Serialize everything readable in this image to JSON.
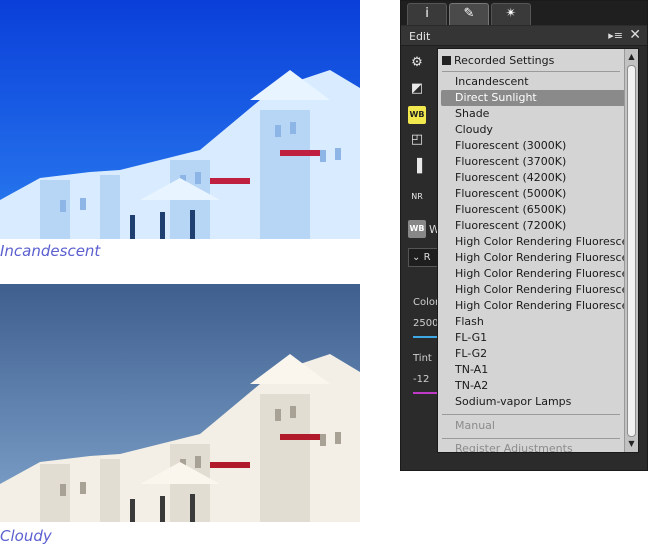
{
  "captions": {
    "top": "Incandescent",
    "bottom": "Cloudy"
  },
  "panel": {
    "tabs": [
      {
        "icon": "info-icon",
        "glyph": "i"
      },
      {
        "icon": "edit-pencil-icon",
        "glyph": "✎"
      },
      {
        "icon": "magic-wand-icon",
        "glyph": "✴"
      }
    ],
    "edit_title": "Edit",
    "header_menu_glyph": "▸≡",
    "header_close_glyph": "✕",
    "tool_icons": {
      "gear": "⚙",
      "exposure": "◩",
      "wb": "WB",
      "levels": "◰",
      "contrast": "▐",
      "nr": "NR"
    },
    "wb_row_label": "W",
    "wb_select_value": "R",
    "color_label": "Color",
    "color_value": "2500",
    "tint_label": "Tint",
    "tint_value": "-12"
  },
  "dropdown": {
    "recorded_label": "Recorded Settings",
    "items": [
      {
        "label": "Incandescent",
        "selected": false
      },
      {
        "label": "Direct Sunlight",
        "selected": true
      },
      {
        "label": "Shade",
        "selected": false
      },
      {
        "label": "Cloudy",
        "selected": false
      },
      {
        "label": "Fluorescent (3000K)",
        "selected": false
      },
      {
        "label": "Fluorescent (3700K)",
        "selected": false
      },
      {
        "label": "Fluorescent (4200K)",
        "selected": false
      },
      {
        "label": "Fluorescent (5000K)",
        "selected": false
      },
      {
        "label": "Fluorescent (6500K)",
        "selected": false
      },
      {
        "label": "Fluorescent (7200K)",
        "selected": false
      },
      {
        "label": "High Color Rendering Fluoresce...",
        "selected": false
      },
      {
        "label": "High Color Rendering Fluoresce...",
        "selected": false
      },
      {
        "label": "High Color Rendering Fluoresce...",
        "selected": false
      },
      {
        "label": "High Color Rendering Fluoresce...",
        "selected": false
      },
      {
        "label": "High Color Rendering Fluoresce...",
        "selected": false
      },
      {
        "label": "Flash",
        "selected": false
      },
      {
        "label": "FL-G1",
        "selected": false
      },
      {
        "label": "FL-G2",
        "selected": false
      },
      {
        "label": "TN-A1",
        "selected": false
      },
      {
        "label": "TN-A2",
        "selected": false
      },
      {
        "label": "Sodium-vapor Lamps",
        "selected": false
      }
    ],
    "manual_label": "Manual",
    "register_label": "Register Adjustments"
  },
  "colors": {
    "caption": "#5b5fd0",
    "wb_icon": "#f2e94e",
    "color_bar": "#3fa9e6",
    "tint_bar": "#c03ac8",
    "selected_row": "#8a8a8a"
  }
}
